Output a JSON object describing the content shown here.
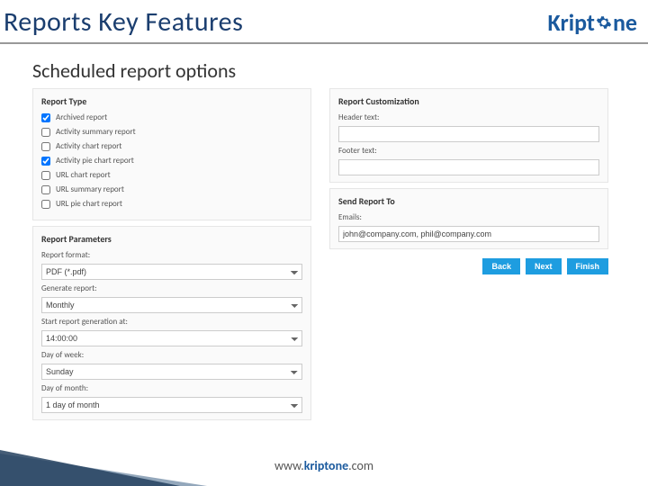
{
  "header": {
    "title": "Reports Key Features",
    "brand": "Kript",
    "brand2": "ne"
  },
  "subtitle": "Scheduled report options",
  "reportType": {
    "title": "Report Type",
    "items": [
      {
        "label": "Archived report",
        "checked": true
      },
      {
        "label": "Activity summary report",
        "checked": false
      },
      {
        "label": "Activity chart report",
        "checked": false
      },
      {
        "label": "Activity pie chart report",
        "checked": true
      },
      {
        "label": "URL chart report",
        "checked": false
      },
      {
        "label": "URL summary report",
        "checked": false
      },
      {
        "label": "URL pie chart report",
        "checked": false
      }
    ]
  },
  "reportParams": {
    "title": "Report Parameters",
    "formatLabel": "Report format:",
    "formatValue": "PDF (*.pdf)",
    "generateLabel": "Generate report:",
    "generateValue": "Monthly",
    "startLabel": "Start report generation at:",
    "startValue": "14:00:00",
    "dowLabel": "Day of week:",
    "dowValue": "Sunday",
    "domLabel": "Day of month:",
    "domValue": "1 day of month"
  },
  "customization": {
    "title": "Report Customization",
    "headerLabel": "Header text:",
    "headerValue": "",
    "footerLabel": "Footer text:",
    "footerValue": ""
  },
  "sendTo": {
    "title": "Send Report To",
    "emailsLabel": "Emails:",
    "emailsValue": "john@company.com, phil@company.com"
  },
  "buttons": {
    "back": "Back",
    "next": "Next",
    "finish": "Finish"
  },
  "footer": {
    "www": "www.",
    "brand": "kriptone",
    "com": ".com"
  }
}
